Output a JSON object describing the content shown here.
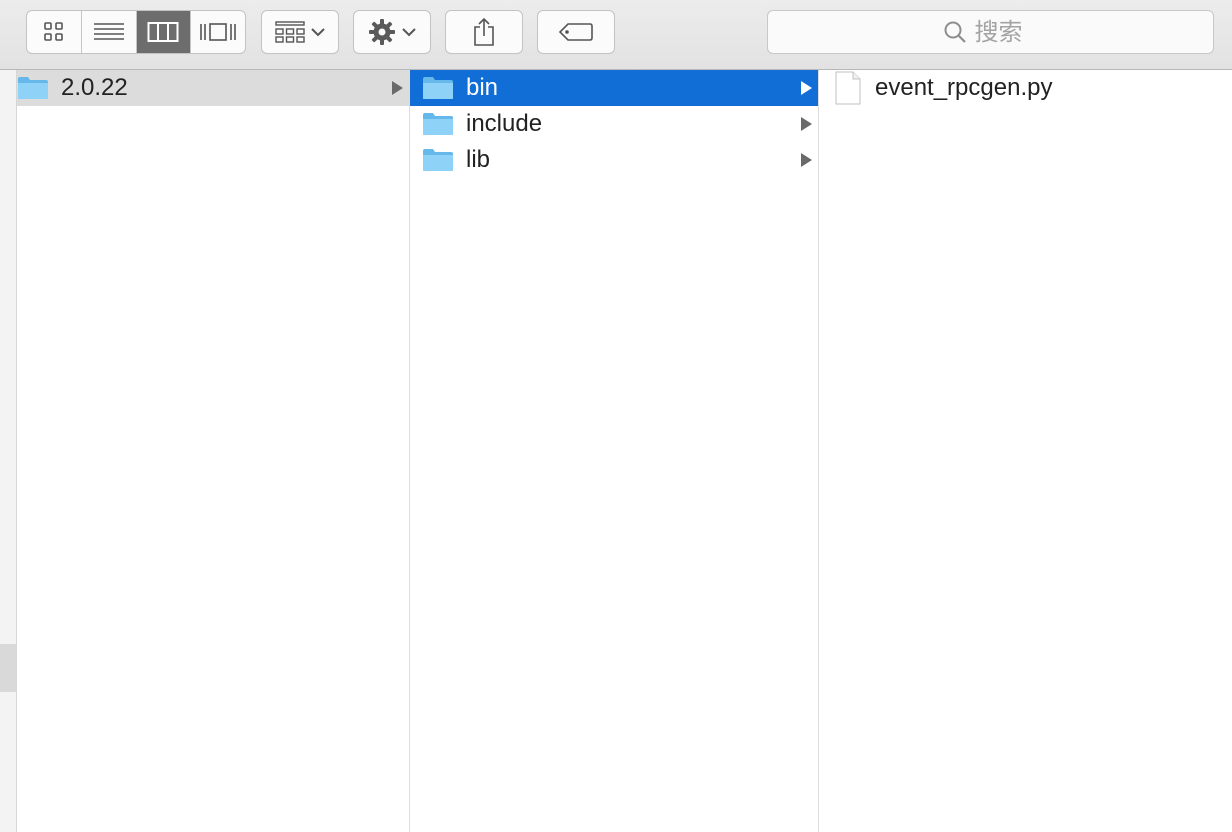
{
  "toolbar": {
    "view_modes": [
      {
        "name": "icon-view",
        "icon": "grid-icon",
        "active": false
      },
      {
        "name": "list-view",
        "icon": "list-icon",
        "active": false
      },
      {
        "name": "column-view",
        "icon": "columns-icon",
        "active": true
      },
      {
        "name": "gallery-view",
        "icon": "cover-flow-icon",
        "active": false
      }
    ],
    "group_button": {
      "icon": "group-icon"
    },
    "action_button": {
      "icon": "gear-icon"
    },
    "share_button": {
      "icon": "share-icon"
    },
    "tag_button": {
      "icon": "tag-icon"
    },
    "search": {
      "placeholder": "搜索",
      "icon": "search-icon"
    }
  },
  "columns": [
    {
      "items": [
        {
          "name": "2.0.22",
          "type": "folder",
          "selected": "inactive"
        }
      ]
    },
    {
      "items": [
        {
          "name": "bin",
          "type": "folder",
          "selected": "active"
        },
        {
          "name": "include",
          "type": "folder",
          "selected": "none"
        },
        {
          "name": "lib",
          "type": "folder",
          "selected": "none"
        }
      ]
    },
    {
      "items": [
        {
          "name": "event_rpcgen.py",
          "type": "file"
        }
      ]
    }
  ],
  "colors": {
    "selection_active": "#116ed6",
    "selection_inactive": "#dcdcdc",
    "folder": "#7dc8f3"
  }
}
